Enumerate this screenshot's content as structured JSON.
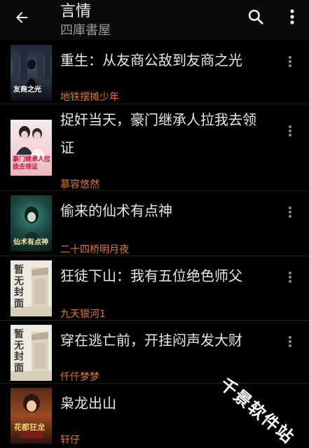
{
  "header": {
    "title": "言情",
    "subtitle": "四庫書屋",
    "icons": [
      "arrow-back-icon",
      "search-icon",
      "more-vert-icon"
    ]
  },
  "books": [
    {
      "title_lines": [
        "重生：从友商公敌到友商之光"
      ],
      "author": "地铁摆摊少年",
      "cover_text": "友商之光"
    },
    {
      "title_lines": [
        "捉奸当天，豪门继承人拉我去领",
        "证"
      ],
      "author": "慕容悠然",
      "cover_text": "豪门继承人拉我去领证"
    },
    {
      "title_lines": [
        "偷来的仙术有点神"
      ],
      "author": "二十四桥明月夜",
      "cover_text": "仙术有点神"
    },
    {
      "title_lines": [
        "狂徒下山：我有五位绝色师父"
      ],
      "author": "九天银河1",
      "cover_text": "暂无封面"
    },
    {
      "title_lines": [
        "穿在逃亡前，开挂闷声发大财"
      ],
      "author": "仟仟梦梦",
      "cover_text": "暂无封面"
    },
    {
      "title_lines": [
        "枭龙出山"
      ],
      "author": "轩仔",
      "cover_text": "花都狂龙"
    }
  ],
  "watermark": "千景软件站",
  "colors": {
    "background": "#000000",
    "author": "#e07a2e",
    "title": "#e8e8e8"
  }
}
